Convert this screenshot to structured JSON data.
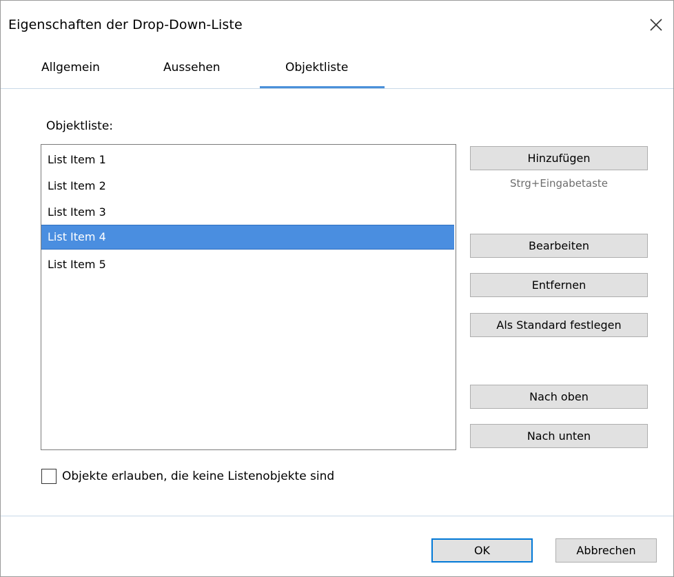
{
  "dialog": {
    "title": "Eigenschaften der Drop-Down-Liste"
  },
  "icons": {
    "close": "close-icon"
  },
  "tabs": [
    {
      "label": "Allgemein",
      "active": false
    },
    {
      "label": "Aussehen",
      "active": false
    },
    {
      "label": "Objektliste",
      "active": true
    }
  ],
  "colors": {
    "accent": "#4a90d9",
    "selection": "#4a8ee0",
    "button_face": "#e1e1e1",
    "default_button_border": "#0078d7",
    "hint_text": "#6d6d6d"
  },
  "list": {
    "label": "Objektliste:",
    "items": [
      "List Item 1",
      "List Item 2",
      "List Item 3",
      "List Item 4",
      "List Item 5"
    ],
    "selected_index": 3
  },
  "buttons": {
    "add": "Hinzufügen",
    "add_hint": "Strg+Eingabetaste",
    "edit": "Bearbeiten",
    "remove": "Entfernen",
    "set_default": "Als Standard festlegen",
    "move_up": "Nach oben",
    "move_down": "Nach unten"
  },
  "options": {
    "allow_non_list_objects": {
      "label": "Objekte erlauben, die keine Listenobjekte sind",
      "checked": false
    }
  },
  "footer": {
    "ok": "OK",
    "cancel": "Abbrechen"
  }
}
